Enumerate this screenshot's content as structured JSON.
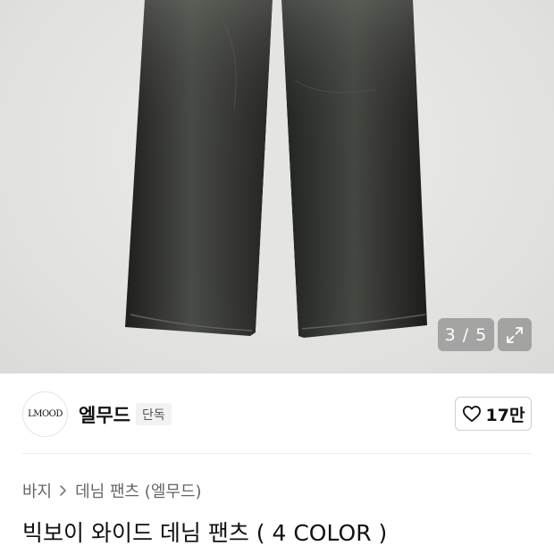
{
  "gallery": {
    "counter": "3 / 5",
    "image_icon": "jeans-product-photo",
    "expand_icon": "expand-arrows-icon"
  },
  "brand": {
    "logo_text": "LMOOD",
    "name": "엘무드",
    "badge": "단독",
    "like_icon": "heart-outline-icon",
    "like_count": "17만"
  },
  "breadcrumb": {
    "category": "바지",
    "separator_icon": "chevron-right-icon",
    "subcategory": "데님 팬츠 (엘무드)"
  },
  "product": {
    "title": "빅보이 와이드 데님 팬츠 ( 4 COLOR )"
  },
  "colors": {
    "denim": "#2a2c29",
    "background": "#e3e3e1",
    "overlay": "#8c8c8c"
  }
}
